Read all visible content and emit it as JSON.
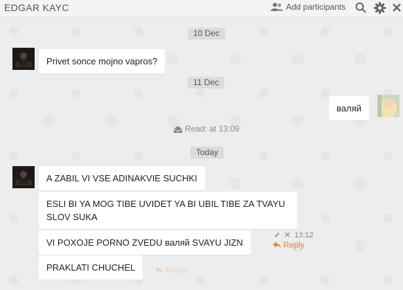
{
  "header": {
    "title": "EDGAR KAYC",
    "add_label": "Add participants"
  },
  "dates": [
    "10 Dec",
    "11 Dec",
    "Today"
  ],
  "messages": [
    {
      "text": "Privet sonce mojno vapros?"
    },
    {
      "text": "валяй"
    },
    {
      "text": "A ZABIL VI VSE ADINAKVIE SUCHKI"
    },
    {
      "text": "ESLI BI YA MOG TIBE UVIDET YA BI UBIL TIBE ZA TVAYU SLOV SUKA"
    },
    {
      "text": "VI POXOJE PORNO ZVEDU валяй SVAYU JIZN"
    },
    {
      "text": "PRAKLATI CHUCHEL"
    }
  ],
  "read_status": "Read: at 13:09",
  "hover_meta": {
    "time": "13:12",
    "reply_label": "Reply"
  },
  "faded_reply": {
    "reply_label": "Reply"
  },
  "colors": {
    "reply": "#e8823a",
    "background": "#ededed"
  }
}
